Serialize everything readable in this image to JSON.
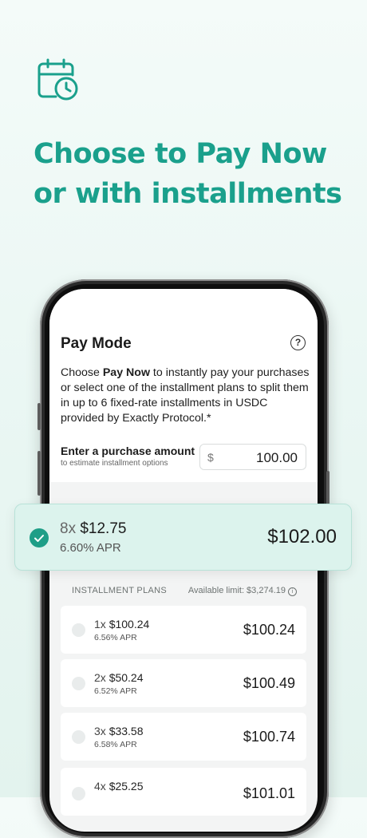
{
  "colors": {
    "brand": "#1aa08c",
    "check_bg": "#1e9e87",
    "selected_bg": "#dcf3ed"
  },
  "hero": {
    "icon": "calendar-clock-icon",
    "headline_line1": "Choose to Pay Now",
    "headline_line2": "or with installments"
  },
  "pay_mode": {
    "title": "Pay Mode",
    "help_icon": "?",
    "desc_part1": "Choose ",
    "desc_bold": "Pay Now",
    "desc_part2": " to instantly pay your purchases or select one of the installment plans to split them in up to 6 fixed-rate installments in USDC provided by Exactly Protocol.*",
    "amount_label": "Enter a purchase amount",
    "amount_sublabel": "to estimate installment options",
    "currency_symbol": "$",
    "amount_value": "100.00"
  },
  "selected_plan": {
    "multiplier": "8x",
    "installment": "$12.75",
    "apr": "6.60% APR",
    "total": "$102.00"
  },
  "plans": {
    "header": "INSTALLMENT PLANS",
    "limit": "Available limit: $3,274.19",
    "info_icon": "i",
    "items": [
      {
        "multiplier": "1x",
        "installment": "$100.24",
        "apr": "6.56% APR",
        "total": "$100.24"
      },
      {
        "multiplier": "2x",
        "installment": "$50.24",
        "apr": "6.52% APR",
        "total": "$100.49"
      },
      {
        "multiplier": "3x",
        "installment": "$33.58",
        "apr": "6.58% APR",
        "total": "$100.74"
      },
      {
        "multiplier": "4x",
        "installment": "$25.25",
        "apr": "",
        "total": "$101.01"
      }
    ]
  }
}
